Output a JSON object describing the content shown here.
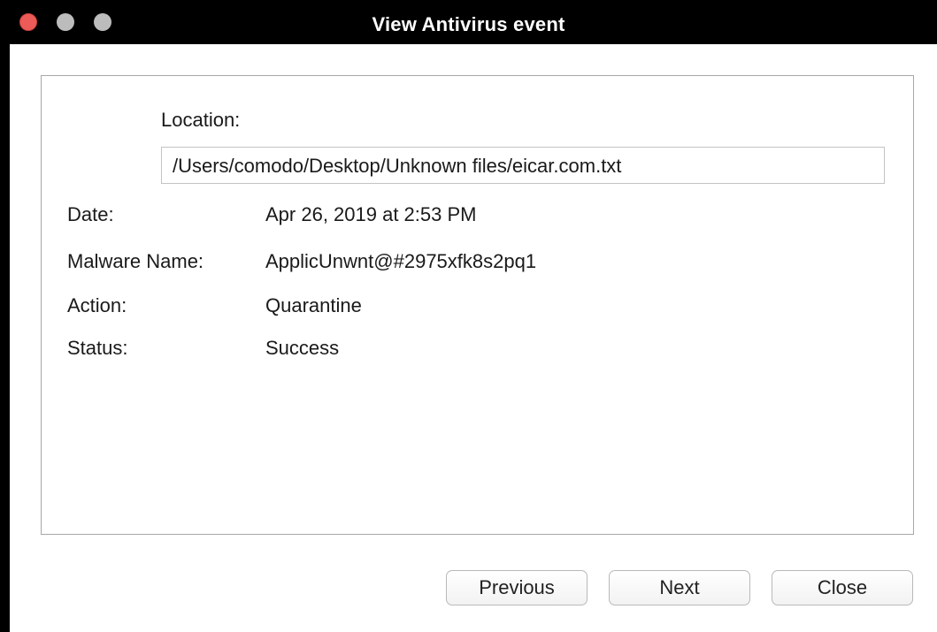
{
  "window": {
    "title": "View Antivirus event"
  },
  "details": {
    "location_label": "Location:",
    "location_value": "/Users/comodo/Desktop/Unknown files/eicar.com.txt",
    "date_label": "Date:",
    "date_value": "Apr 26, 2019 at 2:53 PM",
    "malware_label": "Malware Name:",
    "malware_value": "ApplicUnwnt@#2975xfk8s2pq1",
    "action_label": "Action:",
    "action_value": "Quarantine",
    "status_label": "Status:",
    "status_value": "Success"
  },
  "buttons": {
    "previous": "Previous",
    "next": "Next",
    "close": "Close"
  },
  "colors": {
    "titlebar": "#000000",
    "close_dot": "#ec5b57",
    "inactive_dot": "#bcbcbc"
  }
}
